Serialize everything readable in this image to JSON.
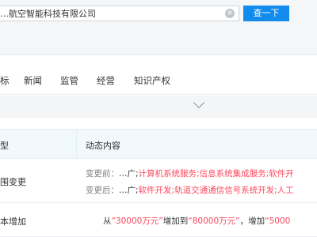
{
  "search": {
    "value": "…航空智能科技有限公司",
    "button_label": "查一下"
  },
  "nav": {
    "items": [
      "标",
      "新闻",
      "监管",
      "经营",
      "知识产权"
    ]
  },
  "table": {
    "headers": [
      "型",
      "动态内容"
    ],
    "rows": [
      {
        "type": "围变更",
        "before_label": "变更前：",
        "before_prefix": "…广;",
        "before_value": "计算机系统服务;信息系统集成服务;软件开",
        "after_label": "变更后：",
        "after_prefix": "…广;",
        "after_value": "软件开发;轨道交通通信信号系统开发;人工"
      },
      {
        "type": "本增加",
        "from_word": "从",
        "from_value": "“30000万元”",
        "to_word": "增加到",
        "to_value": "“80000万元”",
        "inc_word": "，增加",
        "inc_value": "“5000"
      }
    ]
  },
  "colors": {
    "accent": "#128bed",
    "highlight": "#fd485e"
  }
}
